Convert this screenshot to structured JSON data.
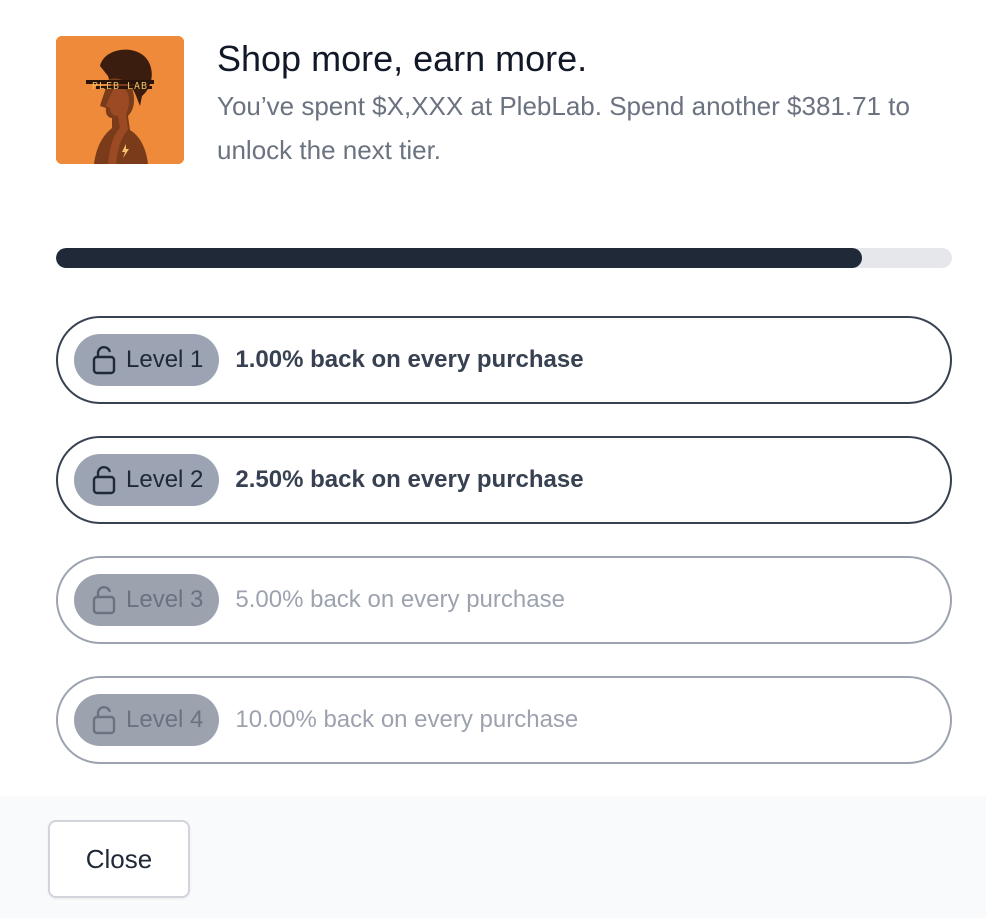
{
  "header": {
    "logo_icon": "pleblab-artist-logo",
    "logo_text": "PLEB LAB",
    "title": "Shop more, earn more.",
    "subtitle": "You’ve spent $X,XXX at PlebLab. Spend another $381.71 to unlock the next tier."
  },
  "progress": {
    "fraction": 0.9
  },
  "tiers": [
    {
      "level": "Level 1",
      "description": "1.00% back on every purchase",
      "unlocked": true
    },
    {
      "level": "Level 2",
      "description": "2.50% back on every purchase",
      "unlocked": true
    },
    {
      "level": "Level 3",
      "description": "5.00% back on every purchase",
      "unlocked": false
    },
    {
      "level": "Level 4",
      "description": "10.00% back on every purchase",
      "unlocked": false
    }
  ],
  "footer": {
    "close_label": "Close"
  },
  "colors": {
    "accent": "#1f2937",
    "logo_bg": "#ef8a3a",
    "badge": "#9ca3b3",
    "muted_text": "#6b7280"
  }
}
